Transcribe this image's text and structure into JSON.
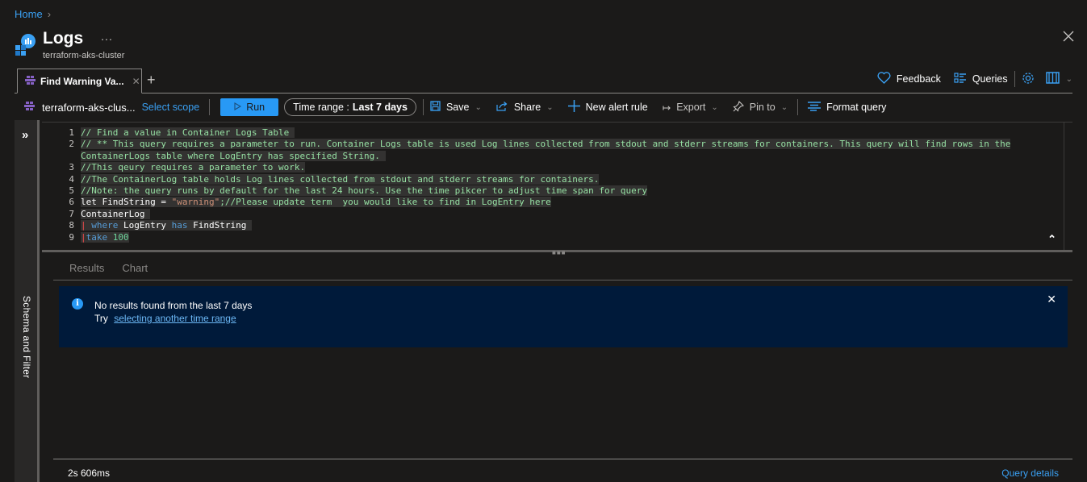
{
  "breadcrumb": {
    "items": [
      {
        "label": "Home"
      }
    ]
  },
  "header": {
    "title": "Logs",
    "more_label": "...",
    "subtitle": "terraform-aks-cluster"
  },
  "tabs": [
    {
      "label": "Find Warning Va...",
      "active": true
    }
  ],
  "tab_add_label": "+",
  "right_tools": {
    "feedback_label": "Feedback",
    "queries_label": "Queries"
  },
  "command_bar": {
    "scope_name": "terraform-aks-clus...",
    "select_scope_label": "Select scope",
    "run_label": "Run",
    "time_range_prefix": "Time range :",
    "time_range_value": "Last 7 days",
    "save_label": "Save",
    "share_label": "Share",
    "new_alert_label": "New alert rule",
    "export_label": "Export",
    "pin_label": "Pin to",
    "format_label": "Format query"
  },
  "side_panel": {
    "label": "Schema and Filter"
  },
  "editor": {
    "line_numbers": [
      "1",
      "2",
      "",
      "3",
      "4",
      "5",
      "6",
      "7",
      "8",
      "9"
    ],
    "lines": [
      [
        {
          "t": "cm",
          "v": "// Find a value in Container Logs Table "
        }
      ],
      [
        {
          "t": "cm",
          "v": "// ** This query requires a parameter to run. Container Logs table is used Log lines collected from stdout and stderr streams for containers. This query will find rows in the"
        }
      ],
      [
        {
          "t": "cm",
          "v": "ContainerLogs table where LogEntry has specified String. "
        }
      ],
      [
        {
          "t": "cm",
          "v": "//This qeury requires a parameter to work."
        }
      ],
      [
        {
          "t": "cm",
          "v": "//The ContainerLog table holds Log lines collected from stdout and stderr streams for containers."
        }
      ],
      [
        {
          "t": "cm",
          "v": "//Note: the query runs by default for the last 24 hours. Use the time pikcer to adjust time span for query"
        }
      ],
      [
        {
          "t": "pl",
          "v": "let FindString = "
        },
        {
          "t": "str",
          "v": "\"warning\""
        },
        {
          "t": "cm",
          "v": ";//Please update term  you would like to find in LogEntry here"
        }
      ],
      [
        {
          "t": "pl",
          "v": "ContainerLog "
        }
      ],
      [
        {
          "t": "pipe",
          "v": "|"
        },
        {
          "t": "kw",
          "v": " where "
        },
        {
          "t": "pl",
          "v": "LogEntry "
        },
        {
          "t": "kw",
          "v": "has "
        },
        {
          "t": "pl",
          "v": "FindString "
        }
      ],
      [
        {
          "t": "pipe",
          "v": "|"
        },
        {
          "t": "kw",
          "v": "take "
        },
        {
          "t": "num",
          "v": "100"
        }
      ]
    ]
  },
  "results": {
    "tabs": [
      {
        "label": "Results"
      },
      {
        "label": "Chart"
      }
    ],
    "banner": {
      "message": "No results found from the last 7 days",
      "try_label": "Try",
      "link_label": "selecting another time range"
    }
  },
  "footer": {
    "duration": "2s 606ms",
    "query_details_label": "Query details"
  },
  "colors": {
    "accent": "#2899f5",
    "link": "#3aa0f3",
    "background": "#1b1a19",
    "banner_bg": "#001a3a",
    "comment": "#96e0a3",
    "keyword": "#569cd6"
  }
}
